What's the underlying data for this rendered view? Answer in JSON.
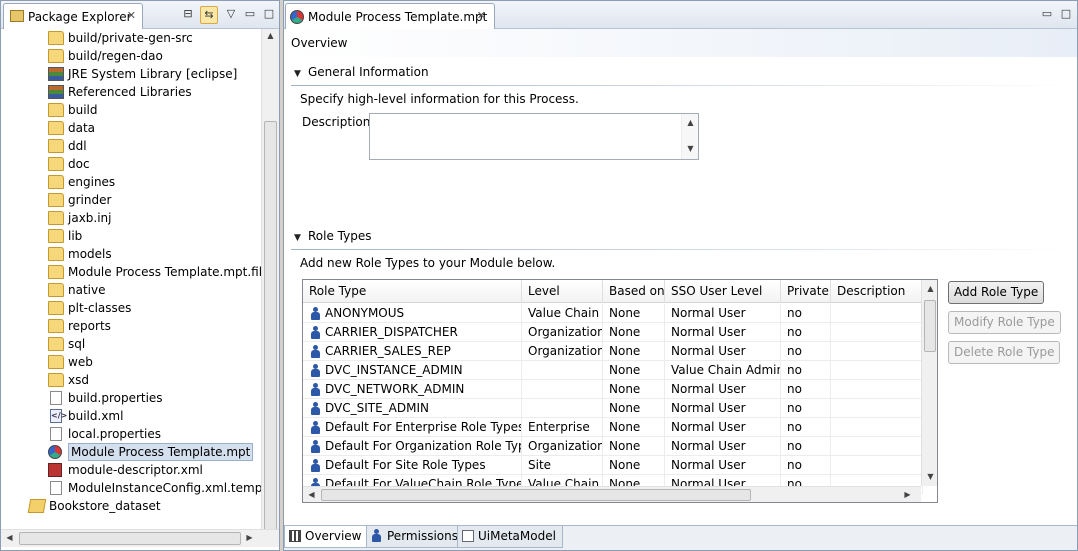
{
  "explorer": {
    "title": "Package Explorer",
    "items": [
      {
        "label": "build/private-gen-src",
        "icon": "source-folder-icon"
      },
      {
        "label": "build/regen-dao",
        "icon": "source-folder-icon"
      },
      {
        "label": "JRE System Library",
        "decoration": "[eclipse]",
        "icon": "library-icon"
      },
      {
        "label": "Referenced Libraries",
        "icon": "library-icon"
      },
      {
        "label": "build",
        "icon": "folder-icon"
      },
      {
        "label": "data",
        "icon": "folder-icon"
      },
      {
        "label": "ddl",
        "icon": "folder-icon"
      },
      {
        "label": "doc",
        "icon": "folder-icon"
      },
      {
        "label": "engines",
        "icon": "folder-icon"
      },
      {
        "label": "grinder",
        "icon": "folder-icon"
      },
      {
        "label": "jaxb.inj",
        "icon": "folder-icon"
      },
      {
        "label": "lib",
        "icon": "folder-icon"
      },
      {
        "label": "models",
        "icon": "folder-icon"
      },
      {
        "label": "Module Process Template.mpt.files",
        "icon": "folder-icon"
      },
      {
        "label": "native",
        "icon": "folder-icon"
      },
      {
        "label": "plt-classes",
        "icon": "folder-icon"
      },
      {
        "label": "reports",
        "icon": "folder-icon"
      },
      {
        "label": "sql",
        "icon": "folder-icon"
      },
      {
        "label": "web",
        "icon": "folder-icon"
      },
      {
        "label": "xsd",
        "icon": "folder-icon"
      },
      {
        "label": "build.properties",
        "icon": "file-icon"
      },
      {
        "label": "build.xml",
        "icon": "xml-file-icon"
      },
      {
        "label": "local.properties",
        "icon": "file-icon"
      },
      {
        "label": "Module Process Template.mpt",
        "icon": "mpt-file-icon"
      },
      {
        "label": "module-descriptor.xml",
        "icon": "descriptor-file-icon"
      },
      {
        "label": "ModuleInstanceConfig.xml.template",
        "icon": "file-icon"
      },
      {
        "label": "Bookstore_dataset",
        "icon": "project-icon"
      }
    ],
    "selected_label": "Module Process Template.mpt"
  },
  "editor": {
    "tab_title": "Module Process Template.mpt",
    "form_title": "Overview",
    "general": {
      "title": "General Information",
      "description_text": "Specify high-level information for this Process.",
      "description_label": "Description:",
      "description_value": ""
    },
    "roles": {
      "title": "Role Types",
      "description_text": "Add new Role Types to your Module below.",
      "columns": [
        "Role Type",
        "Level",
        "Based on",
        "SSO User Level",
        "Private",
        "Description"
      ],
      "rows": [
        [
          "ANONYMOUS",
          "Value Chain",
          "None",
          "Normal User",
          "no",
          ""
        ],
        [
          "CARRIER_DISPATCHER",
          "Organization",
          "None",
          "Normal User",
          "no",
          ""
        ],
        [
          "CARRIER_SALES_REP",
          "Organization",
          "None",
          "Normal User",
          "no",
          ""
        ],
        [
          "DVC_INSTANCE_ADMIN",
          "",
          "None",
          "Value Chain Admin",
          "no",
          ""
        ],
        [
          "DVC_NETWORK_ADMIN",
          "",
          "None",
          "Normal User",
          "no",
          ""
        ],
        [
          "DVC_SITE_ADMIN",
          "",
          "None",
          "Normal User",
          "no",
          ""
        ],
        [
          "Default For Enterprise Role Types",
          "Enterprise",
          "None",
          "Normal User",
          "no",
          ""
        ],
        [
          "Default For Organization Role Types",
          "Organization",
          "None",
          "Normal User",
          "no",
          ""
        ],
        [
          "Default For Site Role Types",
          "Site",
          "None",
          "Normal User",
          "no",
          ""
        ],
        [
          "Default For ValueChain Role Types",
          "Value Chain",
          "None",
          "Normal User",
          "no",
          ""
        ]
      ],
      "buttons": {
        "add": "Add Role Type",
        "modify": "Modify Role Type",
        "delete": "Delete Role Type"
      }
    },
    "page_tabs": [
      {
        "label": "Overview",
        "icon": "structure-icon"
      },
      {
        "label": "Permissions",
        "icon": "person-icon"
      },
      {
        "label": "UiMetaModel",
        "icon": "page-icon"
      }
    ],
    "active_page_tab": "Overview"
  },
  "colors": {
    "selection": "#d5e0ef",
    "role_icon": "#2d58a8",
    "section_line": "#9fb4cc"
  }
}
